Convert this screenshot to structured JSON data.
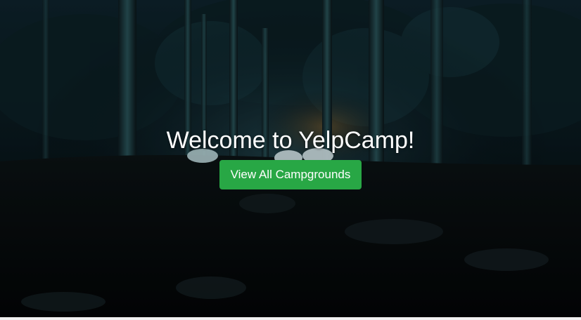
{
  "hero": {
    "title": "Welcome to YelpCamp!",
    "button_label": "View All Campgrounds",
    "button_color": "#28a745",
    "background_image": "night-forest-campsite-with-glowing-tents"
  }
}
